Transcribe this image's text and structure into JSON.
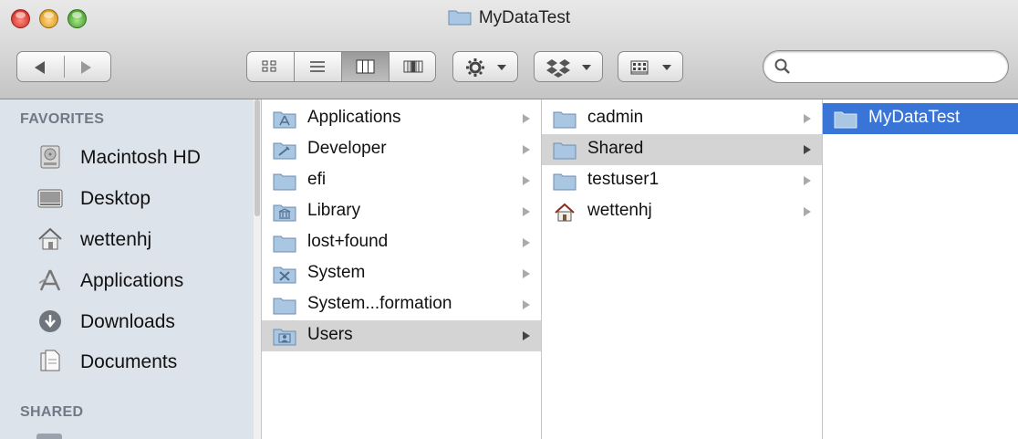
{
  "window": {
    "title": "MyDataTest"
  },
  "toolbar": {
    "search": {
      "placeholder": "",
      "value": ""
    },
    "view_modes": [
      "icon",
      "list",
      "column",
      "coverflow"
    ],
    "active_view": "column"
  },
  "sidebar": {
    "favorites_heading": "FAVORITES",
    "items": [
      {
        "label": "Macintosh HD",
        "icon": "hard-drive-icon"
      },
      {
        "label": "Desktop",
        "icon": "desktop-icon"
      },
      {
        "label": "wettenhj",
        "icon": "home-icon"
      },
      {
        "label": "Applications",
        "icon": "applications-icon"
      },
      {
        "label": "Downloads",
        "icon": "downloads-icon"
      },
      {
        "label": "Documents",
        "icon": "documents-icon"
      }
    ],
    "shared_heading": "SHARED"
  },
  "columns": [
    {
      "items": [
        {
          "label": "Applications",
          "icon": "applications-folder-icon",
          "selected": false
        },
        {
          "label": "Developer",
          "icon": "developer-folder-icon",
          "selected": false
        },
        {
          "label": "efi",
          "icon": "folder-icon",
          "selected": false
        },
        {
          "label": "Library",
          "icon": "library-folder-icon",
          "selected": false
        },
        {
          "label": "lost+found",
          "icon": "folder-icon",
          "selected": false
        },
        {
          "label": "System",
          "icon": "system-folder-icon",
          "selected": false
        },
        {
          "label": "System...formation",
          "icon": "folder-icon",
          "selected": false
        },
        {
          "label": "Users",
          "icon": "users-folder-icon",
          "selected": true
        }
      ]
    },
    {
      "items": [
        {
          "label": "cadmin",
          "icon": "folder-icon",
          "selected": false
        },
        {
          "label": "Shared",
          "icon": "folder-icon",
          "selected": true
        },
        {
          "label": "testuser1",
          "icon": "folder-icon",
          "selected": false
        },
        {
          "label": "wettenhj",
          "icon": "home-icon",
          "selected": false
        }
      ]
    },
    {
      "items": [
        {
          "label": "MyDataTest",
          "icon": "folder-icon",
          "selected": true
        }
      ]
    }
  ],
  "colors": {
    "sidebar_bg": "#dde3ea",
    "selection_active": "#3875d7",
    "selection_inactive": "#d4d4d4",
    "folder_blue": "#a9c6e3"
  }
}
